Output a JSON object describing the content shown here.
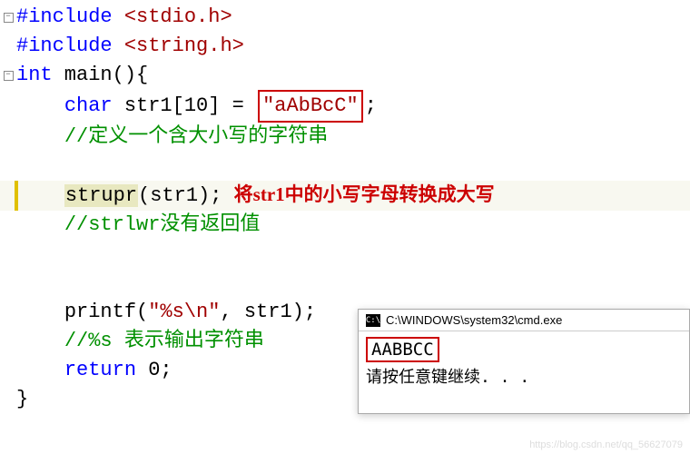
{
  "code": {
    "include1_directive": "#include",
    "include1_path": " <stdio.h>",
    "include2_directive": "#include",
    "include2_path": " <string.h>",
    "main_type": "int",
    "main_name": " main",
    "main_paren": "()",
    "main_brace": "{",
    "decl_type": "char",
    "decl_var": " str1[10] = ",
    "decl_value": "\"aAbBcC\"",
    "decl_semi": ";",
    "comment1": "//定义一个含大小写的字符串",
    "call_func": "strupr",
    "call_args": "(str1);",
    "annotation_pre": "将",
    "annotation_bold": "str1",
    "annotation_post": "中的小写字母转换成大写",
    "comment2": "//strlwr没有返回值",
    "printf_name": "printf",
    "printf_open": "(",
    "printf_fmt": "\"%s\\n\"",
    "printf_rest": ", str1);",
    "comment3": "//%s 表示输出字符串",
    "return_kw": "return",
    "return_val": " 0;",
    "close_brace": "}"
  },
  "cmd": {
    "icon": "C:\\",
    "title": "C:\\WINDOWS\\system32\\cmd.exe",
    "output": "AABBCC",
    "prompt": "请按任意键继续. . ."
  },
  "watermark": "https://blog.csdn.net/qq_56627079"
}
